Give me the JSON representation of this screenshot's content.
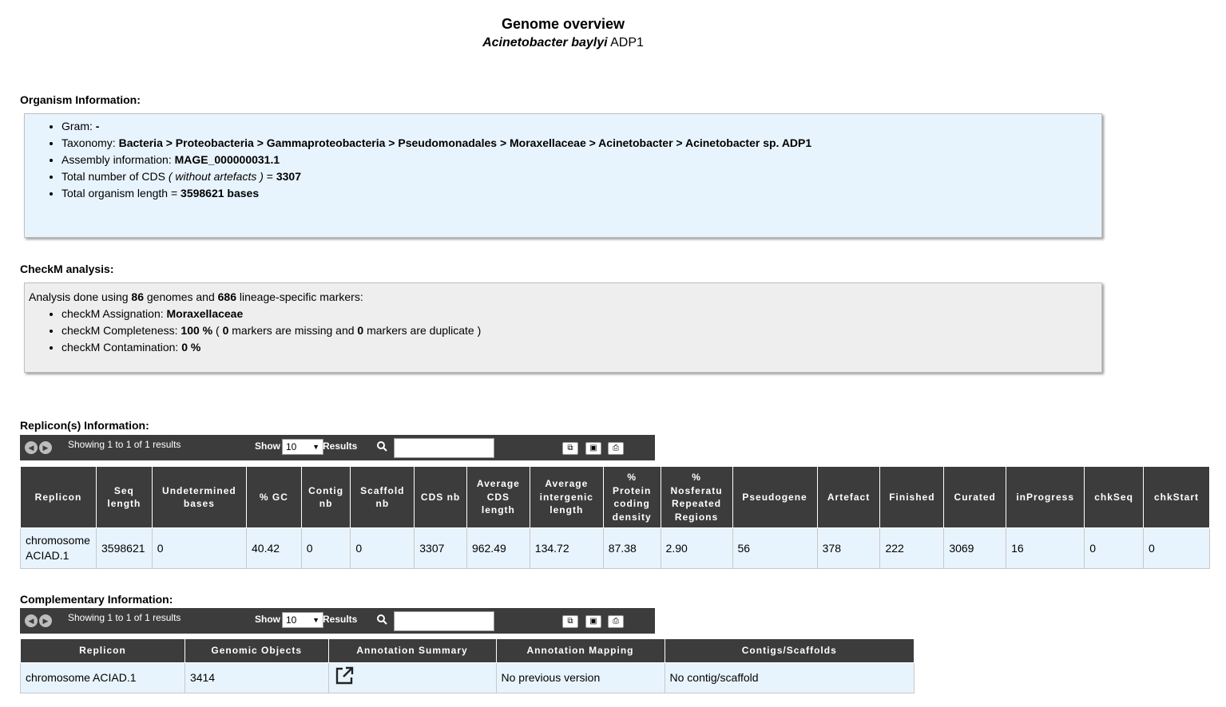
{
  "header": {
    "title": "Genome overview",
    "organism_italic": "Acinetobacter baylyi",
    "organism_strain": "ADP1"
  },
  "organism_info": {
    "title": "Organism Information:",
    "gram_label": "Gram:",
    "gram_value": "-",
    "taxonomy_label": "Taxonomy:",
    "taxonomy_value": "Bacteria > Proteobacteria > Gammaproteobacteria > Pseudomonadales > Moraxellaceae > Acinetobacter > Acinetobacter sp. ADP1",
    "assembly_label": "Assembly information:",
    "assembly_value": "MAGE_000000031.1",
    "cds_label": "Total number of CDS",
    "cds_note": "( without artefacts )",
    "cds_eq": "=",
    "cds_value": "3307",
    "length_label": "Total organism length =",
    "length_value": "3598621 bases"
  },
  "checkm": {
    "title": "CheckM analysis:",
    "intro_1": "Analysis done using",
    "genomes": "86",
    "intro_2": "genomes and",
    "markers": "686",
    "intro_3": "lineage-specific markers:",
    "assignation_label": "checkM Assignation:",
    "assignation_value": "Moraxellaceae",
    "completeness_label": "checkM Completeness:",
    "completeness_value": "100 %",
    "comp_open": "(",
    "missing": "0",
    "comp_mid": "markers are missing and",
    "duplicate": "0",
    "comp_end": "markers are duplicate )",
    "contamination_label": "checkM Contamination:",
    "contamination_value": "0 %"
  },
  "toolbar": {
    "showing": "Showing 1 to 1 of 1 results",
    "show": "Show",
    "page_size": "10",
    "results": "Results",
    "search_placeholder": ""
  },
  "replicons": {
    "title": "Replicon(s) Information:",
    "columns": [
      "Replicon",
      "Seq length",
      "Undetermined bases",
      "% GC",
      "Contig nb",
      "Scaffold nb",
      "CDS nb",
      "Average CDS length",
      "Average intergenic length",
      "% Protein coding density",
      "% Nosferatu Repeated Regions",
      "Pseudogene",
      "Artefact",
      "Finished",
      "Curated",
      "inProgress",
      "chkSeq",
      "chkStart"
    ],
    "rows": [
      [
        "chromosome ACIAD.1",
        "3598621",
        "0",
        "40.42",
        "0",
        "0",
        "3307",
        "962.49",
        "134.72",
        "87.38",
        "2.90",
        "56",
        "378",
        "222",
        "3069",
        "16",
        "0",
        "0"
      ]
    ]
  },
  "complementary": {
    "title": "Complementary Information:",
    "columns": [
      "Replicon",
      "Genomic Objects",
      "Annotation Summary",
      "Annotation Mapping",
      "Contigs/Scaffolds"
    ],
    "rows": [
      [
        "chromosome ACIAD.1",
        "3414",
        "",
        "No previous version",
        "No contig/scaffold"
      ]
    ]
  },
  "icons": {
    "prev": "prev-page-icon",
    "next": "next-page-icon",
    "search": "search-icon",
    "copy": "copy-icon",
    "save": "save-icon",
    "print": "print-icon",
    "open": "external-link-icon"
  }
}
